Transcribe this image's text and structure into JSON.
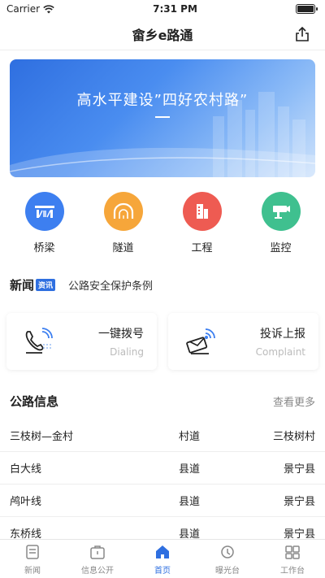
{
  "status_bar": {
    "carrier": "Carrier",
    "time": "7:31 PM"
  },
  "header": {
    "title": "畲乡e路通"
  },
  "banner": {
    "text": "高水平建设”四好农村路”"
  },
  "quick_actions": [
    {
      "label": "桥梁",
      "color": "#3d7ff0"
    },
    {
      "label": "隧道",
      "color": "#f6a63a"
    },
    {
      "label": "工程",
      "color": "#ee5b52"
    },
    {
      "label": "监控",
      "color": "#3fc08f"
    }
  ],
  "news": {
    "logo": "新闻",
    "tag": "资讯",
    "headline": "公路安全保护条例"
  },
  "cards": [
    {
      "title": "一键拨号",
      "subtitle": "Dialing"
    },
    {
      "title": "投诉上报",
      "subtitle": "Complaint"
    }
  ],
  "road_info": {
    "title": "公路信息",
    "more": "查看更多",
    "rows": [
      {
        "name": "三枝树—金村",
        "type": "村道",
        "region": "三枝树村"
      },
      {
        "name": "白大线",
        "type": "县道",
        "region": "景宁县"
      },
      {
        "name": "鸬叶线",
        "type": "县道",
        "region": "景宁县"
      },
      {
        "name": "东桥线",
        "type": "县道",
        "region": "景宁县"
      }
    ]
  },
  "tabs": [
    {
      "label": "新闻"
    },
    {
      "label": "信息公开"
    },
    {
      "label": "首页"
    },
    {
      "label": "曝光台"
    },
    {
      "label": "工作台"
    }
  ],
  "colors": {
    "accent": "#2f6fe0"
  }
}
